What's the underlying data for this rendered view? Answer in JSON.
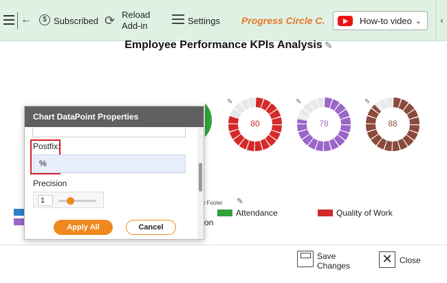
{
  "toolbar": {
    "subscribed_label": "Subscribed",
    "reload_label_1": "Reload",
    "reload_label_2": "Add-in",
    "settings_label": "Settings",
    "brand_label": "Progress Circle C...",
    "howto_label": "How-to video"
  },
  "chart_data": {
    "type": "pie",
    "title": "Employee Performance KPIs Analysis",
    "series": [
      {
        "value": 80,
        "value_label": "80",
        "color": "#d42a2a"
      },
      {
        "value": 78,
        "value_label": "78",
        "color": "#9a66c8"
      },
      {
        "value": 88,
        "value_label": "88",
        "color": "#8a4a3c"
      }
    ],
    "legend_items": [
      "Attendance",
      "Quality of Work"
    ],
    "legend_colors": [
      "#2fa23a",
      "#d42a2a"
    ],
    "footer_fragment": "art Footer",
    "partial_label": "on"
  },
  "dialog": {
    "title": "Chart DataPoint Properties",
    "postfix_label": "Postfix:",
    "postfix_value": "%",
    "precision_label": "Precision",
    "precision_value": "1",
    "apply_label": "Apply All",
    "cancel_label": "Cancel"
  },
  "footer": {
    "save_label_1": "Save",
    "save_label_2": "Changes",
    "close_label": "Close"
  }
}
